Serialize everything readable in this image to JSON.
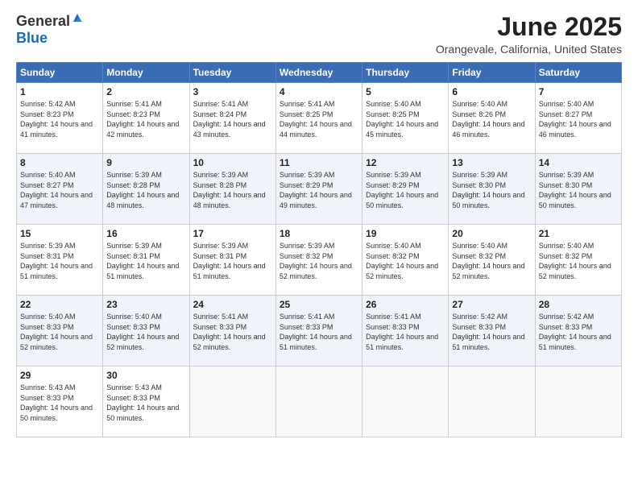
{
  "header": {
    "logo_general": "General",
    "logo_blue": "Blue",
    "title": "June 2025",
    "location": "Orangevale, California, United States"
  },
  "days_of_week": [
    "Sunday",
    "Monday",
    "Tuesday",
    "Wednesday",
    "Thursday",
    "Friday",
    "Saturday"
  ],
  "weeks": [
    [
      {
        "day": "1",
        "sunrise": "5:42 AM",
        "sunset": "8:23 PM",
        "daylight": "14 hours and 41 minutes."
      },
      {
        "day": "2",
        "sunrise": "5:41 AM",
        "sunset": "8:23 PM",
        "daylight": "14 hours and 42 minutes."
      },
      {
        "day": "3",
        "sunrise": "5:41 AM",
        "sunset": "8:24 PM",
        "daylight": "14 hours and 43 minutes."
      },
      {
        "day": "4",
        "sunrise": "5:41 AM",
        "sunset": "8:25 PM",
        "daylight": "14 hours and 44 minutes."
      },
      {
        "day": "5",
        "sunrise": "5:40 AM",
        "sunset": "8:25 PM",
        "daylight": "14 hours and 45 minutes."
      },
      {
        "day": "6",
        "sunrise": "5:40 AM",
        "sunset": "8:26 PM",
        "daylight": "14 hours and 46 minutes."
      },
      {
        "day": "7",
        "sunrise": "5:40 AM",
        "sunset": "8:27 PM",
        "daylight": "14 hours and 46 minutes."
      }
    ],
    [
      {
        "day": "8",
        "sunrise": "5:40 AM",
        "sunset": "8:27 PM",
        "daylight": "14 hours and 47 minutes."
      },
      {
        "day": "9",
        "sunrise": "5:39 AM",
        "sunset": "8:28 PM",
        "daylight": "14 hours and 48 minutes."
      },
      {
        "day": "10",
        "sunrise": "5:39 AM",
        "sunset": "8:28 PM",
        "daylight": "14 hours and 48 minutes."
      },
      {
        "day": "11",
        "sunrise": "5:39 AM",
        "sunset": "8:29 PM",
        "daylight": "14 hours and 49 minutes."
      },
      {
        "day": "12",
        "sunrise": "5:39 AM",
        "sunset": "8:29 PM",
        "daylight": "14 hours and 50 minutes."
      },
      {
        "day": "13",
        "sunrise": "5:39 AM",
        "sunset": "8:30 PM",
        "daylight": "14 hours and 50 minutes."
      },
      {
        "day": "14",
        "sunrise": "5:39 AM",
        "sunset": "8:30 PM",
        "daylight": "14 hours and 50 minutes."
      }
    ],
    [
      {
        "day": "15",
        "sunrise": "5:39 AM",
        "sunset": "8:31 PM",
        "daylight": "14 hours and 51 minutes."
      },
      {
        "day": "16",
        "sunrise": "5:39 AM",
        "sunset": "8:31 PM",
        "daylight": "14 hours and 51 minutes."
      },
      {
        "day": "17",
        "sunrise": "5:39 AM",
        "sunset": "8:31 PM",
        "daylight": "14 hours and 51 minutes."
      },
      {
        "day": "18",
        "sunrise": "5:39 AM",
        "sunset": "8:32 PM",
        "daylight": "14 hours and 52 minutes."
      },
      {
        "day": "19",
        "sunrise": "5:40 AM",
        "sunset": "8:32 PM",
        "daylight": "14 hours and 52 minutes."
      },
      {
        "day": "20",
        "sunrise": "5:40 AM",
        "sunset": "8:32 PM",
        "daylight": "14 hours and 52 minutes."
      },
      {
        "day": "21",
        "sunrise": "5:40 AM",
        "sunset": "8:32 PM",
        "daylight": "14 hours and 52 minutes."
      }
    ],
    [
      {
        "day": "22",
        "sunrise": "5:40 AM",
        "sunset": "8:33 PM",
        "daylight": "14 hours and 52 minutes."
      },
      {
        "day": "23",
        "sunrise": "5:40 AM",
        "sunset": "8:33 PM",
        "daylight": "14 hours and 52 minutes."
      },
      {
        "day": "24",
        "sunrise": "5:41 AM",
        "sunset": "8:33 PM",
        "daylight": "14 hours and 52 minutes."
      },
      {
        "day": "25",
        "sunrise": "5:41 AM",
        "sunset": "8:33 PM",
        "daylight": "14 hours and 51 minutes."
      },
      {
        "day": "26",
        "sunrise": "5:41 AM",
        "sunset": "8:33 PM",
        "daylight": "14 hours and 51 minutes."
      },
      {
        "day": "27",
        "sunrise": "5:42 AM",
        "sunset": "8:33 PM",
        "daylight": "14 hours and 51 minutes."
      },
      {
        "day": "28",
        "sunrise": "5:42 AM",
        "sunset": "8:33 PM",
        "daylight": "14 hours and 51 minutes."
      }
    ],
    [
      {
        "day": "29",
        "sunrise": "5:43 AM",
        "sunset": "8:33 PM",
        "daylight": "14 hours and 50 minutes."
      },
      {
        "day": "30",
        "sunrise": "5:43 AM",
        "sunset": "8:33 PM",
        "daylight": "14 hours and 50 minutes."
      },
      null,
      null,
      null,
      null,
      null
    ]
  ]
}
